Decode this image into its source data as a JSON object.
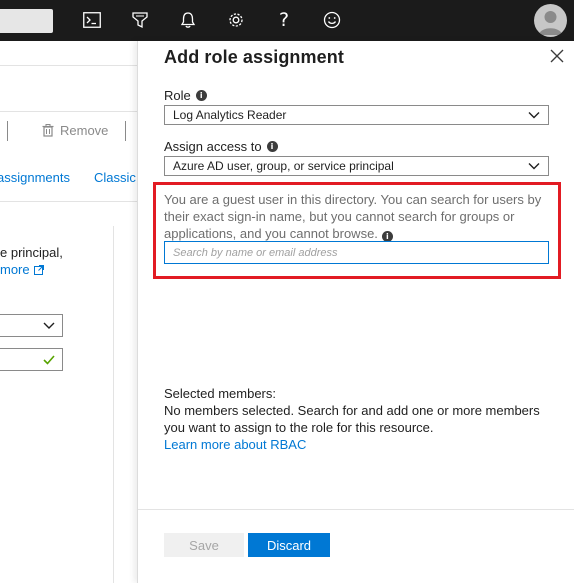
{
  "topbar": {
    "icons": [
      "cloud-shell-icon",
      "directory-filter-icon",
      "notifications-icon",
      "settings-icon",
      "help-icon",
      "feedback-icon"
    ],
    "help_glyph": "?"
  },
  "background_page": {
    "toolbar": {
      "remove_label": "Remove"
    },
    "tabs": [
      "assignments",
      "Classic"
    ],
    "text_line": "e principal,",
    "link_text": "more"
  },
  "blade": {
    "title": "Add role assignment",
    "role": {
      "label": "Role",
      "value": "Log Analytics Reader"
    },
    "assign_access": {
      "label": "Assign access to",
      "value": "Azure AD user, group, or service principal"
    },
    "guest_note": "You are a guest user in this directory. You can search for users by their exact sign-in name, but you cannot search for groups or applications, and you cannot browse.",
    "search": {
      "placeholder": "Search by name or email address",
      "value": ""
    },
    "selected_members": {
      "heading": "Selected members:",
      "message": "No members selected. Search for and add one or more members you want to assign to the role for this resource.",
      "link": "Learn more about RBAC"
    },
    "buttons": {
      "save": "Save",
      "discard": "Discard"
    }
  },
  "colors": {
    "topbar_bg": "#1b1b1b",
    "accent": "#0078d4",
    "highlight": "#e21b23",
    "success": "#57a300"
  }
}
